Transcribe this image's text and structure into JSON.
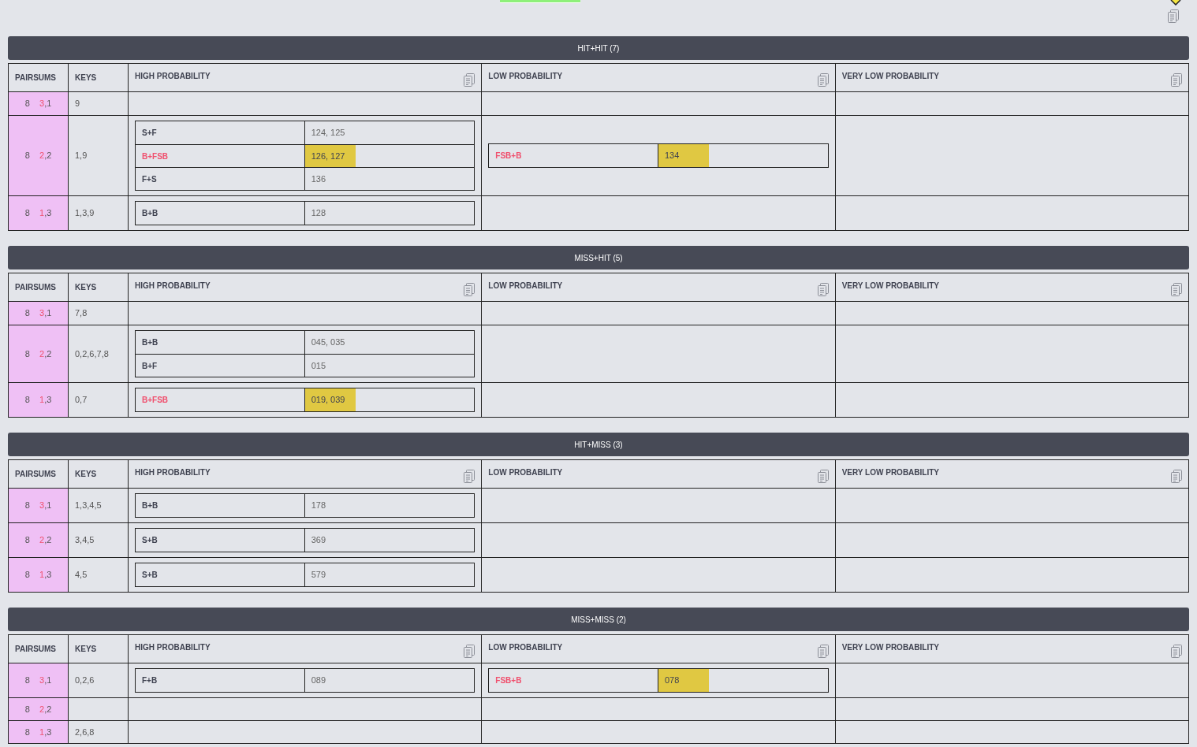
{
  "sections": [
    {
      "title": "HIT+HIT (7)",
      "columns": [
        "PAIRSUMS",
        "KEYS",
        "HIGH PROBABILITY",
        "LOW PROBABILITY",
        "VERY LOW PROBABILITY"
      ],
      "rows": [
        {
          "cells": [
            {
              "sum": "8",
              "first": "3",
              "rest": ",1"
            },
            "9",
            "",
            "",
            ""
          ]
        },
        {
          "cells": [
            {
              "sum": "8",
              "first": "2",
              "rest": ",2"
            },
            "1,9",
            [
              {
                "label": "S+F",
                "value": "124, 125",
                "alert": false,
                "highlighted": false
              },
              {
                "label": "B+FSB",
                "value": "126, 127",
                "alert": true,
                "highlighted": true
              },
              {
                "label": "F+S",
                "value": "136",
                "alert": false,
                "highlighted": false
              }
            ],
            [
              {
                "label": "FSB+B",
                "value": "134",
                "alert": true,
                "highlighted": true
              }
            ],
            ""
          ]
        },
        {
          "cells": [
            {
              "sum": "8",
              "first": "1",
              "rest": ",3"
            },
            "1,3,9",
            [
              {
                "label": "B+B",
                "value": "128",
                "alert": false,
                "highlighted": false
              }
            ],
            "",
            ""
          ]
        }
      ]
    },
    {
      "title": "MISS+HIT (5)",
      "columns": [
        "PAIRSUMS",
        "KEYS",
        "HIGH PROBABILITY",
        "LOW PROBABILITY",
        "VERY LOW PROBABILITY"
      ],
      "rows": [
        {
          "cells": [
            {
              "sum": "8",
              "first": "3",
              "rest": ",1"
            },
            "7,8",
            "",
            "",
            ""
          ]
        },
        {
          "cells": [
            {
              "sum": "8",
              "first": "2",
              "rest": ",2"
            },
            "0,2,6,7,8",
            [
              {
                "label": "B+B",
                "value": "045, 035",
                "alert": false,
                "highlighted": false
              },
              {
                "label": "B+F",
                "value": "015",
                "alert": false,
                "highlighted": false
              }
            ],
            "",
            ""
          ]
        },
        {
          "cells": [
            {
              "sum": "8",
              "first": "1",
              "rest": ",3"
            },
            "0,7",
            [
              {
                "label": "B+FSB",
                "value": "019, 039",
                "alert": true,
                "highlighted": true
              }
            ],
            "",
            ""
          ]
        }
      ]
    },
    {
      "title": "HIT+MISS (3)",
      "columns": [
        "PAIRSUMS",
        "KEYS",
        "HIGH PROBABILITY",
        "LOW PROBABILITY",
        "VERY LOW PROBABILITY"
      ],
      "rows": [
        {
          "cells": [
            {
              "sum": "8",
              "first": "3",
              "rest": ",1"
            },
            "1,3,4,5",
            [
              {
                "label": "B+B",
                "value": "178",
                "alert": false,
                "highlighted": false
              }
            ],
            "",
            ""
          ]
        },
        {
          "cells": [
            {
              "sum": "8",
              "first": "2",
              "rest": ",2"
            },
            "3,4,5",
            [
              {
                "label": "S+B",
                "value": "369",
                "alert": false,
                "highlighted": false
              }
            ],
            "",
            ""
          ]
        },
        {
          "cells": [
            {
              "sum": "8",
              "first": "1",
              "rest": ",3"
            },
            "4,5",
            [
              {
                "label": "S+B",
                "value": "579",
                "alert": false,
                "highlighted": false
              }
            ],
            "",
            ""
          ]
        }
      ]
    },
    {
      "title": "MISS+MISS (2)",
      "columns": [
        "PAIRSUMS",
        "KEYS",
        "HIGH PROBABILITY",
        "LOW PROBABILITY",
        "VERY LOW PROBABILITY"
      ],
      "rows": [
        {
          "cells": [
            {
              "sum": "8",
              "first": "3",
              "rest": ",1"
            },
            "0,2,6",
            [
              {
                "label": "F+B",
                "value": "089",
                "alert": false,
                "highlighted": false
              }
            ],
            [
              {
                "label": "FSB+B",
                "value": "078",
                "alert": true,
                "highlighted": true
              }
            ],
            ""
          ]
        },
        {
          "cells": [
            {
              "sum": "8",
              "first": "2",
              "rest": ",2"
            },
            "",
            "",
            "",
            ""
          ]
        },
        {
          "cells": [
            {
              "sum": "8",
              "first": "1",
              "rest": ",3"
            },
            "2,6,8",
            "",
            "",
            ""
          ]
        }
      ]
    }
  ]
}
